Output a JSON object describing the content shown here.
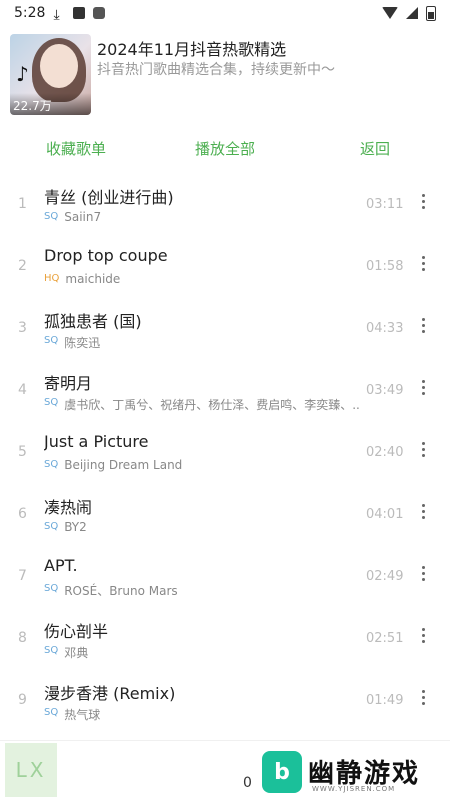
{
  "status": {
    "time": "5:28"
  },
  "playlist": {
    "title": "2024年11月抖音热歌精选",
    "subtitle": "抖音热门歌曲精选合集，持续更新中～",
    "play_count": "22.7万"
  },
  "actions": {
    "favorite": "收藏歌单",
    "play_all": "播放全部",
    "back": "返回"
  },
  "songs": [
    {
      "index": "1",
      "title": "青丝 (创业进行曲)",
      "quality": "SQ",
      "artist": "Saiin7",
      "duration": "03:11"
    },
    {
      "index": "2",
      "title": "Drop top coupe",
      "quality": "HQ",
      "artist": "maichide",
      "duration": "01:58"
    },
    {
      "index": "3",
      "title": "孤独患者 (国)",
      "quality": "SQ",
      "artist": "陈奕迅",
      "duration": "04:33"
    },
    {
      "index": "4",
      "title": "寄明月",
      "quality": "SQ",
      "artist": "虞书欣、丁禹兮、祝绪丹、杨仕泽、费启鸣、李奕臻、...",
      "duration": "03:49"
    },
    {
      "index": "5",
      "title": "Just a Picture",
      "quality": "SQ",
      "artist": "Beijing Dream Land",
      "duration": "02:40"
    },
    {
      "index": "6",
      "title": "凑热闹",
      "quality": "SQ",
      "artist": "BY2",
      "duration": "04:01"
    },
    {
      "index": "7",
      "title": "APT.",
      "quality": "SQ",
      "artist": "ROSÉ、Bruno Mars",
      "duration": "02:49"
    },
    {
      "index": "8",
      "title": "伤心剖半",
      "quality": "SQ",
      "artist": "邓典",
      "duration": "02:51"
    },
    {
      "index": "9",
      "title": "漫步香港 (Remix)",
      "quality": "SQ",
      "artist": "热气球",
      "duration": "01:49"
    }
  ],
  "player": {
    "logo_text": "LX",
    "count": "0"
  },
  "watermark": {
    "mark": "b",
    "name": "幽静游戏",
    "url": "WWW.YJISREN.COM"
  },
  "colors": {
    "accent": "#4caf50",
    "sq_badge": "#6aa8d8",
    "hq_badge": "#e9a13b"
  }
}
